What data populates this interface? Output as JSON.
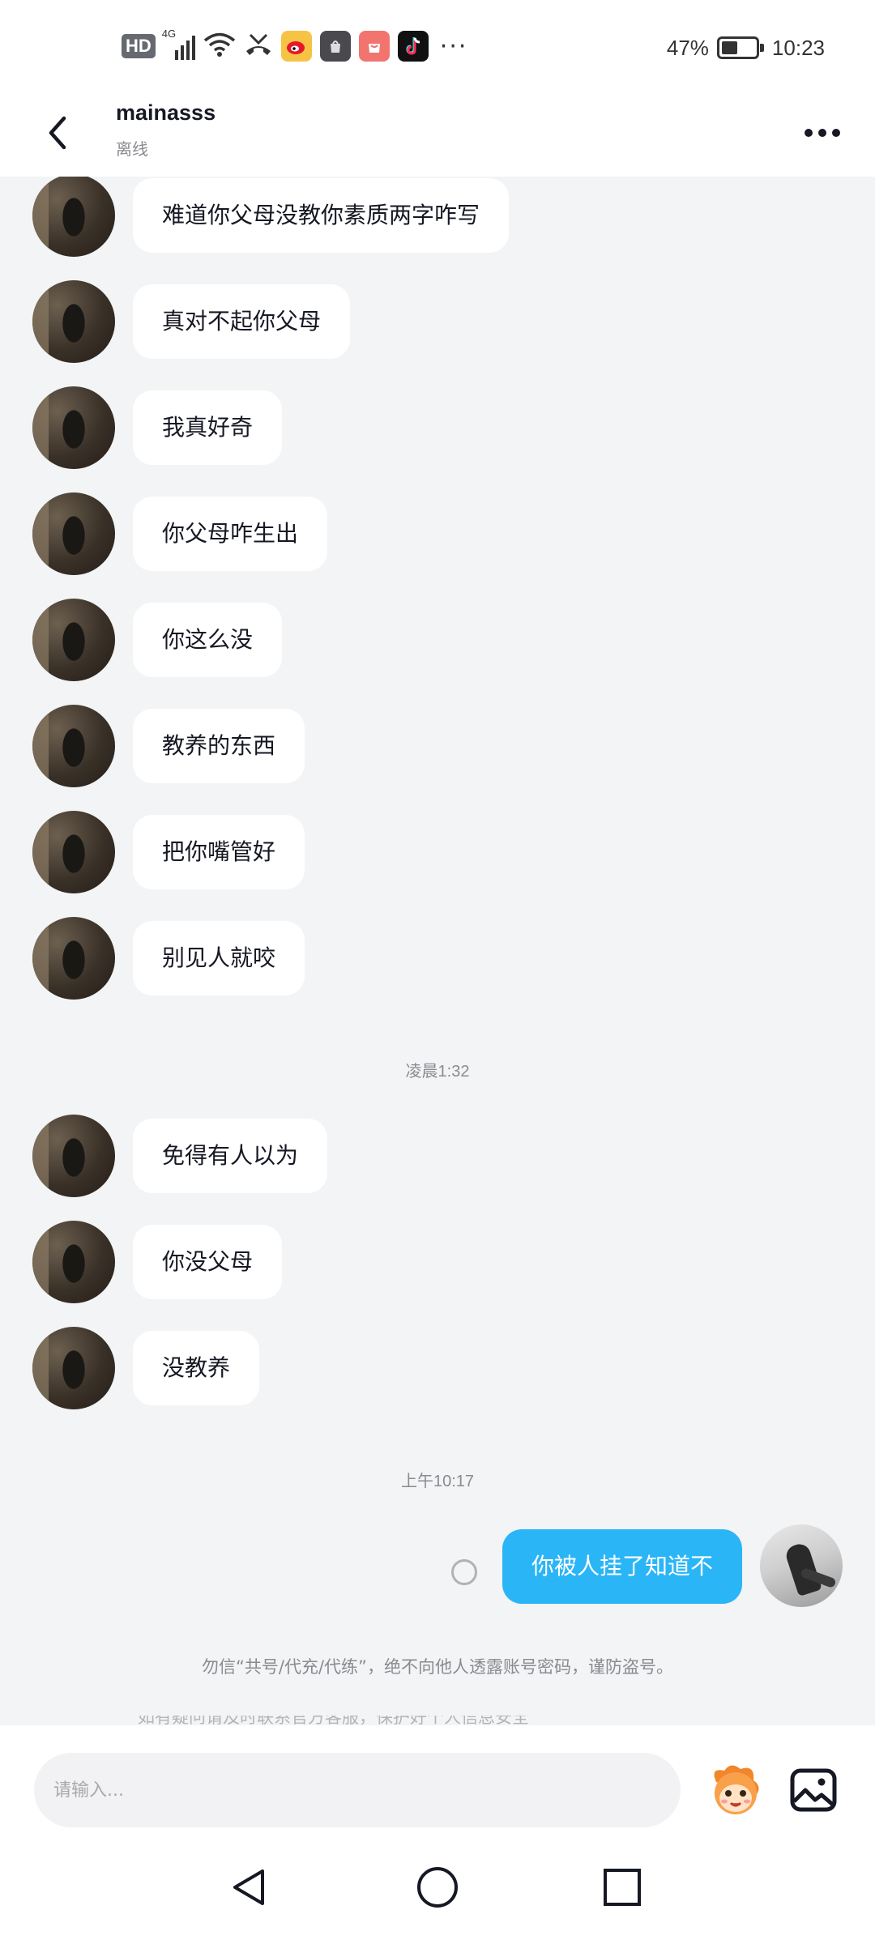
{
  "status_bar": {
    "hd": "HD",
    "network": "4G",
    "more": "···",
    "battery_percent": "47%",
    "battery_level": 0.47,
    "time": "10:23"
  },
  "header": {
    "contact_name": "mainasss",
    "contact_status": "离线"
  },
  "messages": {
    "received_group_1": [
      "难道你父母没教你素质两字咋写",
      "真对不起你父母",
      "我真好奇",
      "你父母咋生出",
      "你这么没",
      "教养的东西",
      "把你嘴管好",
      "别见人就咬"
    ],
    "timestamp_1": "凌晨1:32",
    "received_group_2": [
      "免得有人以为",
      "你没父母",
      "没教养"
    ],
    "timestamp_2": "上午10:17",
    "sent": "你被人挂了知道不"
  },
  "notice": {
    "security": "勿信“共号/代充/代练”，绝不向他人透露账号密码，谨防盗号。",
    "cut_off_text": "如有疑问请及时联系官方客服，保护好个人信息安全"
  },
  "input": {
    "placeholder": "请输入..."
  },
  "icons": {
    "back": "back-arrow-icon",
    "more": "more-dots-icon",
    "sticker": "sticker-face-icon",
    "image": "image-icon",
    "nav_back": "triangle-back-icon",
    "nav_home": "circle-home-icon",
    "nav_recent": "square-recent-icon"
  },
  "colors": {
    "sent_bubble": "#2ab5f7",
    "received_bubble": "#ffffff",
    "chat_background": "#f2f4f5",
    "secondary_text": "#8a8b91"
  }
}
